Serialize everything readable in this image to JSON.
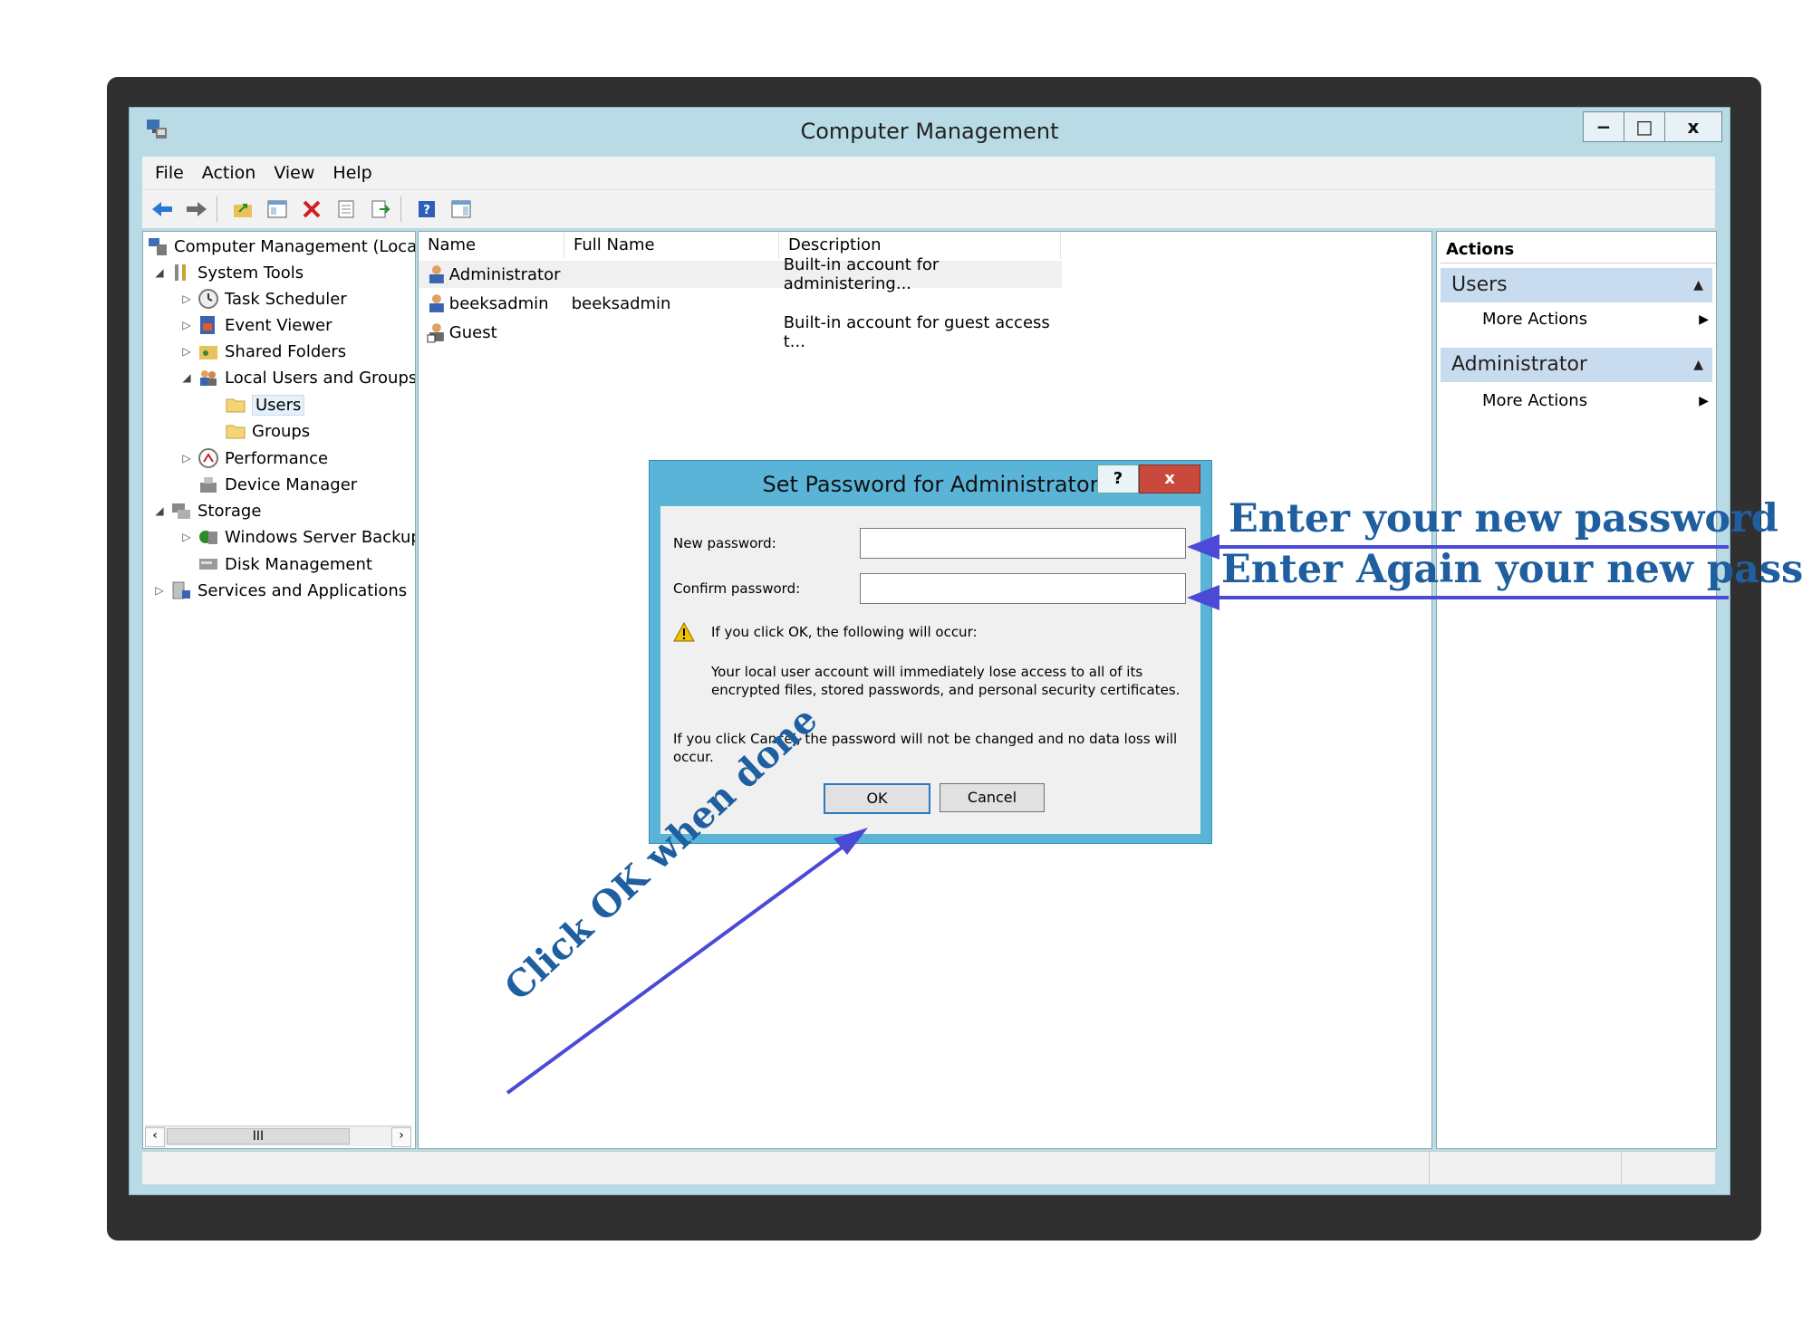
{
  "window": {
    "title": "Computer Management"
  },
  "window_buttons": {
    "minimize": "−",
    "maximize": "□",
    "close": "x"
  },
  "menu": [
    "File",
    "Action",
    "View",
    "Help"
  ],
  "tree": {
    "items": [
      {
        "label": "Computer Management (Local",
        "icon": "computer-management-icon",
        "expander": "",
        "level": 0
      },
      {
        "label": "System Tools",
        "icon": "tools-icon",
        "expander": "◢",
        "level": 1
      },
      {
        "label": "Task Scheduler",
        "icon": "clock-icon",
        "expander": "▷",
        "level": 2
      },
      {
        "label": "Event Viewer",
        "icon": "event-viewer-icon",
        "expander": "▷",
        "level": 2
      },
      {
        "label": "Shared Folders",
        "icon": "shared-folder-icon",
        "expander": "▷",
        "level": 2
      },
      {
        "label": "Local Users and Groups",
        "icon": "users-group-icon",
        "expander": "◢",
        "level": 2
      },
      {
        "label": "Users",
        "icon": "folder-icon",
        "expander": "",
        "level": 3,
        "selected": true
      },
      {
        "label": "Groups",
        "icon": "folder-icon",
        "expander": "",
        "level": 3
      },
      {
        "label": "Performance",
        "icon": "performance-icon",
        "expander": "▷",
        "level": 2
      },
      {
        "label": "Device Manager",
        "icon": "device-manager-icon",
        "expander": "",
        "level": 2
      },
      {
        "label": "Storage",
        "icon": "storage-icon",
        "expander": "◢",
        "level": 1
      },
      {
        "label": "Windows Server Backup",
        "icon": "backup-icon",
        "expander": "▷",
        "level": 2
      },
      {
        "label": "Disk Management",
        "icon": "disk-icon",
        "expander": "",
        "level": 2
      },
      {
        "label": "Services and Applications",
        "icon": "services-icon",
        "expander": "▷",
        "level": 1
      }
    ],
    "scroll_thumb": "III"
  },
  "list": {
    "columns": [
      "Name",
      "Full Name",
      "Description"
    ],
    "rows": [
      {
        "name": "Administrator",
        "full_name": "",
        "description": "Built-in account for administering..."
      },
      {
        "name": "beeksadmin",
        "full_name": "beeksadmin",
        "description": ""
      },
      {
        "name": "Guest",
        "full_name": "",
        "description": "Built-in account for guest access t..."
      }
    ]
  },
  "actions": {
    "header": "Actions",
    "sections": [
      {
        "title": "Users",
        "item": "More Actions"
      },
      {
        "title": "Administrator",
        "item": "More Actions"
      }
    ]
  },
  "dialog": {
    "title": "Set Password for Administrator",
    "help": "?",
    "close": "x",
    "new_password_label": "New password:",
    "confirm_password_label": "Confirm password:",
    "new_password_value": "",
    "confirm_password_value": "",
    "warning_intro": "If you click OK, the following will occur:",
    "warning_line1": "Your local user account will immediately lose access to all of its",
    "warning_line2": "encrypted files, stored passwords, and personal security certificates.",
    "cancel_line1": "If you click Cancel, the password will not be changed and no data loss will",
    "cancel_line2": "occur.",
    "ok": "OK",
    "cancel": "Cancel"
  },
  "annotations": {
    "enter_password": "Enter your new password",
    "enter_again": "Enter Again your new pass",
    "click_ok": "Click OK when done",
    "color": "#1f5fa0",
    "arrow_color": "#4a4ad6"
  }
}
